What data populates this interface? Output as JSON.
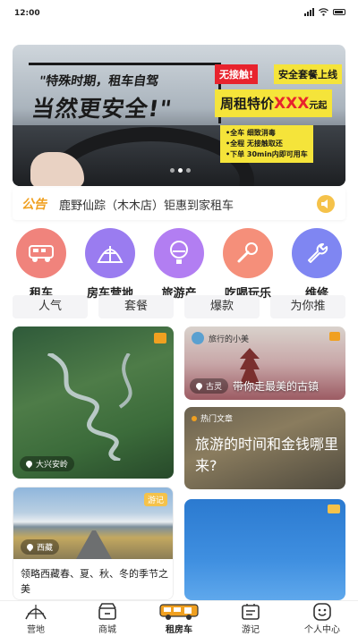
{
  "status_bar": {
    "time": "12:00"
  },
  "banner": {
    "headline_line1": "\"特殊时期，租车自驾",
    "headline_line2": "当然更安全!\"",
    "tag_red": "无接触!",
    "tag_yellow": "安全套餐上线",
    "price_prefix": "周租特价",
    "price_value": "XXX",
    "price_unit": "元起",
    "features": [
      "•全车 细致消毒",
      "•全程 无接触取还",
      "•下单 30min内即可用车"
    ]
  },
  "notice": {
    "logo": "公告",
    "text": "鹿野仙踪（木木店）钜惠到家租车"
  },
  "categories": [
    {
      "label": "租车",
      "icon": "rv-icon",
      "color": "#f0837c"
    },
    {
      "label": "房车营地",
      "icon": "tent-icon",
      "color": "#9a7cf0"
    },
    {
      "label": "旅游产",
      "icon": "balloon-icon",
      "color": "#b27ef2"
    },
    {
      "label": "吃喝玩乐",
      "icon": "microphone-icon",
      "color": "#f58f7a"
    },
    {
      "label": "维修",
      "icon": "wrench-icon",
      "color": "#7f86f2"
    }
  ],
  "tabs": [
    "人气",
    "套餐",
    "爆款",
    "为你推"
  ],
  "feed": {
    "card1": {
      "location": "大兴安岭"
    },
    "card2": {
      "author": "旅行的小美",
      "location": "古灵",
      "caption": "带你走最美的古镇"
    },
    "card3": {
      "label": "热门文章",
      "title": "旅游的时间和金钱哪里来?"
    },
    "card4": {
      "badge": "游记",
      "location": "西藏",
      "text": "领略西藏春、夏、秋、冬的季节之美"
    }
  },
  "bottom_nav": [
    {
      "label": "营地",
      "icon": "camp-icon"
    },
    {
      "label": "商城",
      "icon": "shop-icon"
    },
    {
      "label": "租房车",
      "icon": "rv-rent-icon",
      "active": true
    },
    {
      "label": "游记",
      "icon": "travel-notes-icon"
    },
    {
      "label": "个人中心",
      "icon": "profile-icon"
    }
  ]
}
